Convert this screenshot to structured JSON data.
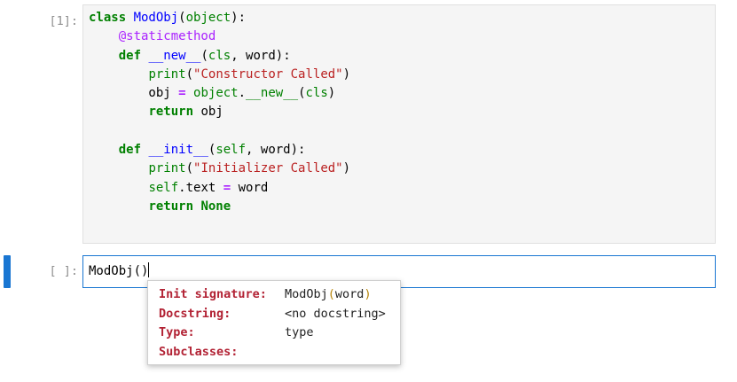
{
  "cells": [
    {
      "prompt": "[1]:",
      "code_lines": [
        [
          {
            "t": "class ",
            "c": "kw"
          },
          {
            "t": "ModObj",
            "c": "def"
          },
          {
            "t": "(",
            "c": ""
          },
          {
            "t": "object",
            "c": "bi"
          },
          {
            "t": "):",
            "c": ""
          }
        ],
        [
          {
            "t": "    ",
            "c": ""
          },
          {
            "t": "@staticmethod",
            "c": "deco"
          }
        ],
        [
          {
            "t": "    ",
            "c": ""
          },
          {
            "t": "def ",
            "c": "kw"
          },
          {
            "t": "__new__",
            "c": "def"
          },
          {
            "t": "(",
            "c": ""
          },
          {
            "t": "cls",
            "c": "bi"
          },
          {
            "t": ", word):",
            "c": ""
          }
        ],
        [
          {
            "t": "        ",
            "c": ""
          },
          {
            "t": "print",
            "c": "bi"
          },
          {
            "t": "(",
            "c": ""
          },
          {
            "t": "\"Constructor Called\"",
            "c": "str"
          },
          {
            "t": ")",
            "c": ""
          }
        ],
        [
          {
            "t": "        obj ",
            "c": ""
          },
          {
            "t": "=",
            "c": "op"
          },
          {
            "t": " ",
            "c": ""
          },
          {
            "t": "object",
            "c": "bi"
          },
          {
            "t": ".",
            "c": ""
          },
          {
            "t": "__new__",
            "c": "bi"
          },
          {
            "t": "(",
            "c": ""
          },
          {
            "t": "cls",
            "c": "bi"
          },
          {
            "t": ")",
            "c": ""
          }
        ],
        [
          {
            "t": "        ",
            "c": ""
          },
          {
            "t": "return",
            "c": "kw"
          },
          {
            "t": " obj",
            "c": ""
          }
        ],
        [
          {
            "t": "",
            "c": ""
          }
        ],
        [
          {
            "t": "    ",
            "c": ""
          },
          {
            "t": "def ",
            "c": "kw"
          },
          {
            "t": "__init__",
            "c": "def"
          },
          {
            "t": "(",
            "c": ""
          },
          {
            "t": "self",
            "c": "bi"
          },
          {
            "t": ", word):",
            "c": ""
          }
        ],
        [
          {
            "t": "        ",
            "c": ""
          },
          {
            "t": "print",
            "c": "bi"
          },
          {
            "t": "(",
            "c": ""
          },
          {
            "t": "\"Initializer Called\"",
            "c": "str"
          },
          {
            "t": ")",
            "c": ""
          }
        ],
        [
          {
            "t": "        ",
            "c": ""
          },
          {
            "t": "self",
            "c": "bi"
          },
          {
            "t": ".text ",
            "c": ""
          },
          {
            "t": "=",
            "c": "op"
          },
          {
            "t": " word",
            "c": ""
          }
        ],
        [
          {
            "t": "        ",
            "c": ""
          },
          {
            "t": "return",
            "c": "kw"
          },
          {
            "t": " ",
            "c": ""
          },
          {
            "t": "None",
            "c": "kw"
          }
        ]
      ]
    },
    {
      "prompt": "[ ]:",
      "input_text": "ModObj",
      "open_paren": "(",
      "close_paren": ")"
    }
  ],
  "tooltip": {
    "rows": [
      {
        "key": "Init signature:",
        "value_name": "ModObj",
        "value_open": "(",
        "value_args": "word",
        "value_close": ")"
      },
      {
        "key": "Docstring:",
        "value": "<no docstring>"
      },
      {
        "key": "Type:",
        "value": "type"
      },
      {
        "key": "Subclasses:",
        "value": ""
      }
    ]
  },
  "colors": {
    "active_cell": "#1976d2",
    "keyword": "#008000",
    "string": "#ba2121",
    "definition": "#0000ff",
    "decorator": "#aa22ff",
    "tooltip_key": "#b22234"
  }
}
